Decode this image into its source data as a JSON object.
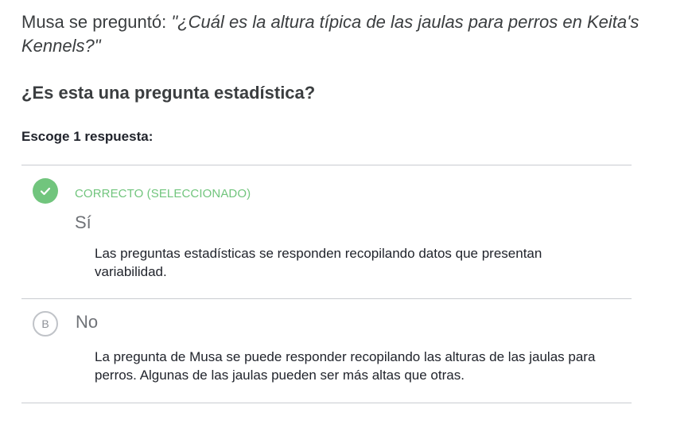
{
  "question": {
    "lead": "Musa se preguntó: ",
    "quote": "\"¿Cuál es la altura típica de las jaulas para perros en Keita's Kennels?\""
  },
  "prompt": "¿Es esta una pregunta estadística?",
  "instructions": "Escoge 1 respuesta:",
  "choices": [
    {
      "status": "CORRECTO (SELECCIONADO)",
      "label": "Sí",
      "rationale": "Las preguntas estadísticas se responden recopilando datos que presentan variabilidad.",
      "icon": "check-icon",
      "selected": true
    },
    {
      "letter": "B",
      "label": "No",
      "rationale": "La pregunta de Musa se puede responder recopilando las alturas de las jaulas para perros. Algunas de las jaulas pueden ser más altas que otras.",
      "selected": false
    }
  ],
  "colors": {
    "correct": "#71c57d",
    "divider": "#c9ccd1",
    "text": "#21242c",
    "muted": "#6f7277"
  }
}
